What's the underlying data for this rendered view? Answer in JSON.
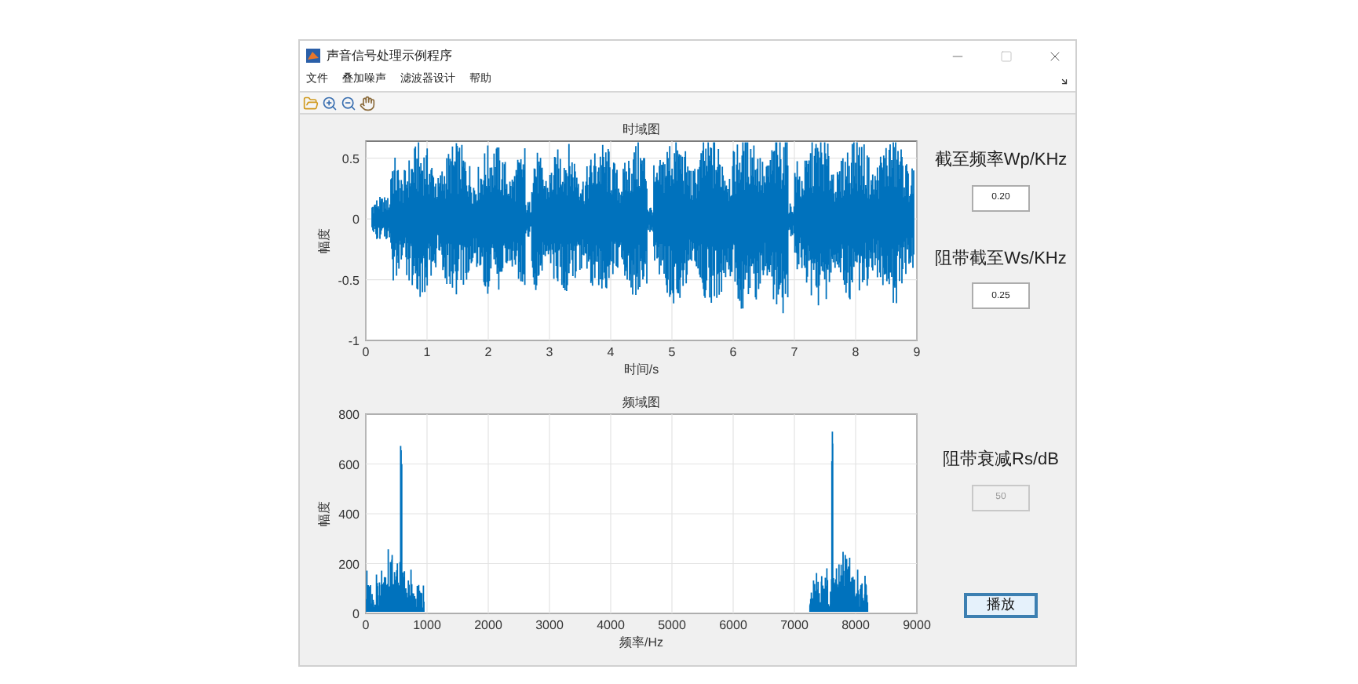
{
  "window": {
    "title": "声音信号处理示例程序"
  },
  "menu": [
    "文件",
    "叠加噪声",
    "滤波器设计",
    "帮助"
  ],
  "plots": [
    {
      "kind": "waveform",
      "title": "时域图",
      "xlabel": "时间/s",
      "ylabel": "幅度",
      "xticks": [
        "0",
        "1",
        "2",
        "3",
        "4",
        "5",
        "6",
        "7",
        "8",
        "9"
      ],
      "yticks": [
        "0.5",
        "0",
        "-0.5",
        "-1"
      ]
    },
    {
      "kind": "spectrum",
      "title": "频域图",
      "xlabel": "频率/Hz",
      "ylabel": "幅度",
      "xticks": [
        "0",
        "1000",
        "2000",
        "3000",
        "4000",
        "5000",
        "6000",
        "7000",
        "8000",
        "9000"
      ],
      "yticks": [
        "800",
        "600",
        "400",
        "200",
        "0"
      ]
    }
  ],
  "parameters": [
    {
      "label": "截至频率Wp/KHz",
      "value": "0.20",
      "disabled": false
    },
    {
      "label": "阻带截至Ws/KHz",
      "value": "0.25",
      "disabled": false
    },
    {
      "label": "阻带衰减Rs/dB",
      "value": "50",
      "disabled": true
    }
  ],
  "play_button": "播放"
}
